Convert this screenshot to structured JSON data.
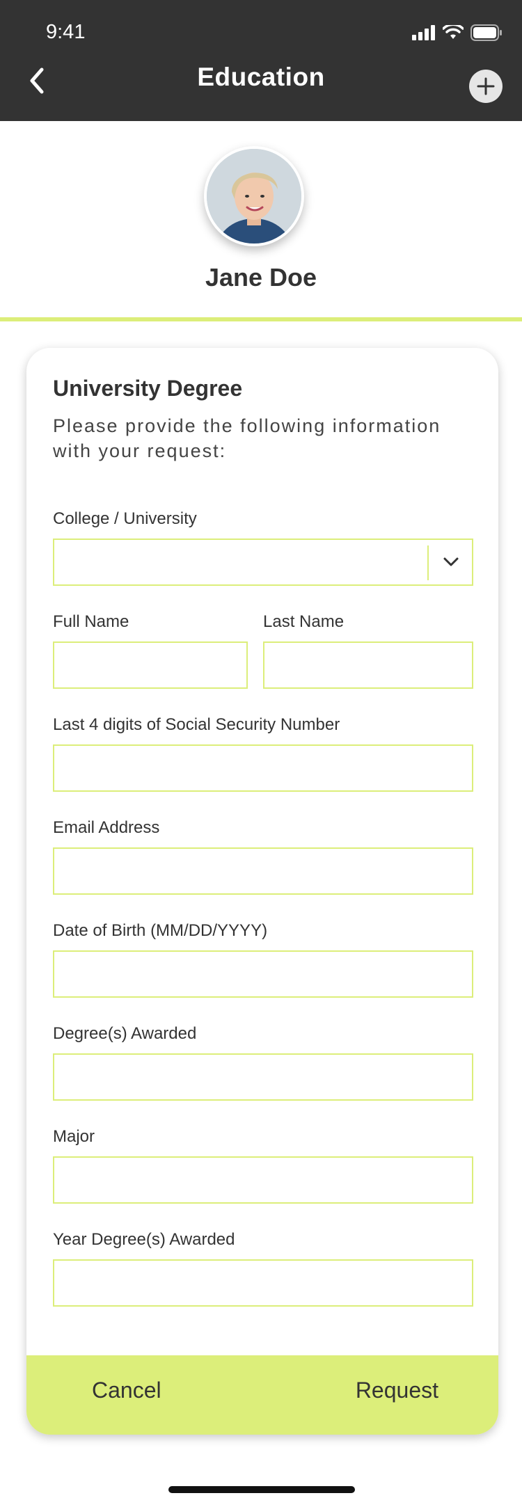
{
  "status_bar": {
    "time": "9:41"
  },
  "header": {
    "title": "Education"
  },
  "profile": {
    "name": "Jane Doe"
  },
  "form": {
    "title": "University Degree",
    "subtitle": "Please provide the following information with your request:",
    "college_label": "College / University",
    "college_value": "",
    "full_name_label": "Full Name",
    "full_name_value": "",
    "last_name_label": "Last Name",
    "last_name_value": "",
    "ssn_label": "Last 4 digits of Social Security Number",
    "ssn_value": "",
    "email_label": "Email Address",
    "email_value": "",
    "dob_label": "Date of Birth (MM/DD/YYYY)",
    "dob_value": "",
    "degree_label": "Degree(s) Awarded",
    "degree_value": "",
    "major_label": "Major",
    "major_value": "",
    "year_label": "Year Degree(s) Awarded",
    "year_value": ""
  },
  "actions": {
    "cancel_label": "Cancel",
    "request_label": "Request"
  },
  "theme": {
    "accent": "#dcee7a",
    "header_bg": "#333333",
    "text": "#333333"
  },
  "icons": [
    "signal-icon",
    "wifi-icon",
    "battery-icon",
    "back-chevron-icon",
    "plus-icon",
    "chevron-down-icon"
  ]
}
